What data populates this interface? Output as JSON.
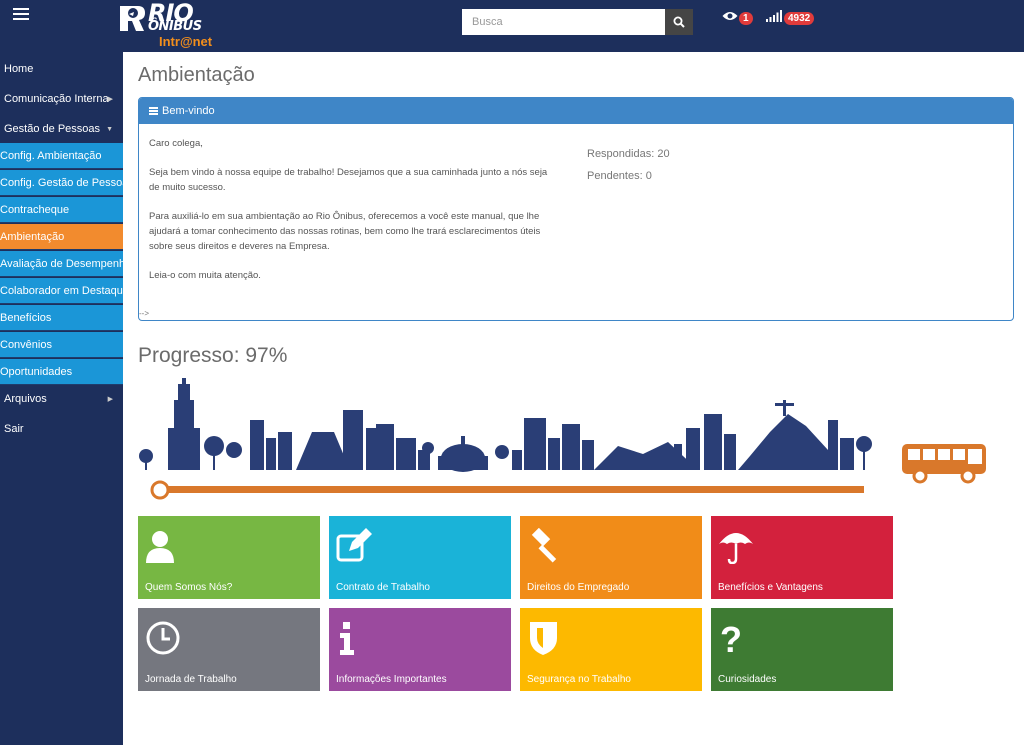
{
  "header": {
    "logo_rio": "RIO",
    "logo_onibus": "ÔNIBUS",
    "logo_intranet": "Intr@net",
    "search_placeholder": "Busca",
    "views_badge": "1",
    "signal_badge": "4932"
  },
  "sidebar": {
    "items": [
      {
        "label": "Home"
      },
      {
        "label": "Comunicação Interna"
      },
      {
        "label": "Gestão de Pessoas"
      }
    ],
    "subitems": [
      {
        "label": "Config. Ambientação"
      },
      {
        "label": "Config. Gestão de Pessoas"
      },
      {
        "label": "Contracheque"
      },
      {
        "label": "Ambientação"
      },
      {
        "label": "Avaliação de Desempenho"
      },
      {
        "label": "Colaborador em Destaque"
      },
      {
        "label": "Benefícios"
      },
      {
        "label": "Convênios"
      },
      {
        "label": "Oportunidades"
      }
    ],
    "bottom_items": [
      {
        "label": "Arquivos"
      },
      {
        "label": "Sair"
      }
    ]
  },
  "main": {
    "title": "Ambientação",
    "panel": {
      "heading": "Bem-vindo",
      "greeting": "Caro colega,",
      "p1": "Seja bem vindo à nossa equipe de trabalho! Desejamos que a sua caminhada junto a nós seja de muito sucesso.",
      "p2": "Para auxiliá-lo em sua ambientação ao Rio Ônibus, oferecemos a você este manual, que lhe ajudará a tomar conhecimento das nossas rotinas, bem como lhe trará esclarecimentos úteis sobre seus direitos e deveres na Empresa.",
      "p3": "Leia-o com muita atenção.",
      "respondidas": "Respondidas: 20",
      "pendentes": "Pendentes: 0",
      "comment_end": "-->"
    },
    "progress": {
      "title": "Progresso: 97%",
      "value": 0.97
    },
    "tiles": [
      {
        "label": "Quem Somos Nós?",
        "icon": "user-icon",
        "color": "#77b743"
      },
      {
        "label": "Contrato de Trabalho",
        "icon": "edit-icon",
        "color": "#1ab3d8"
      },
      {
        "label": "Direitos do Empregado",
        "icon": "gavel-icon",
        "color": "#f18c18"
      },
      {
        "label": "Benefícios e Vantagens",
        "icon": "umbrella-icon",
        "color": "#d3213d"
      },
      {
        "label": "Jornada de Trabalho",
        "icon": "clock-icon",
        "color": "#75777f"
      },
      {
        "label": "Informações Importantes",
        "icon": "info-icon",
        "color": "#9b4a9e"
      },
      {
        "label": "Segurança no Trabalho",
        "icon": "shield-icon",
        "color": "#fdb900"
      },
      {
        "label": "Curiosidades",
        "icon": "question-icon",
        "color": "#3e7b33"
      }
    ]
  }
}
